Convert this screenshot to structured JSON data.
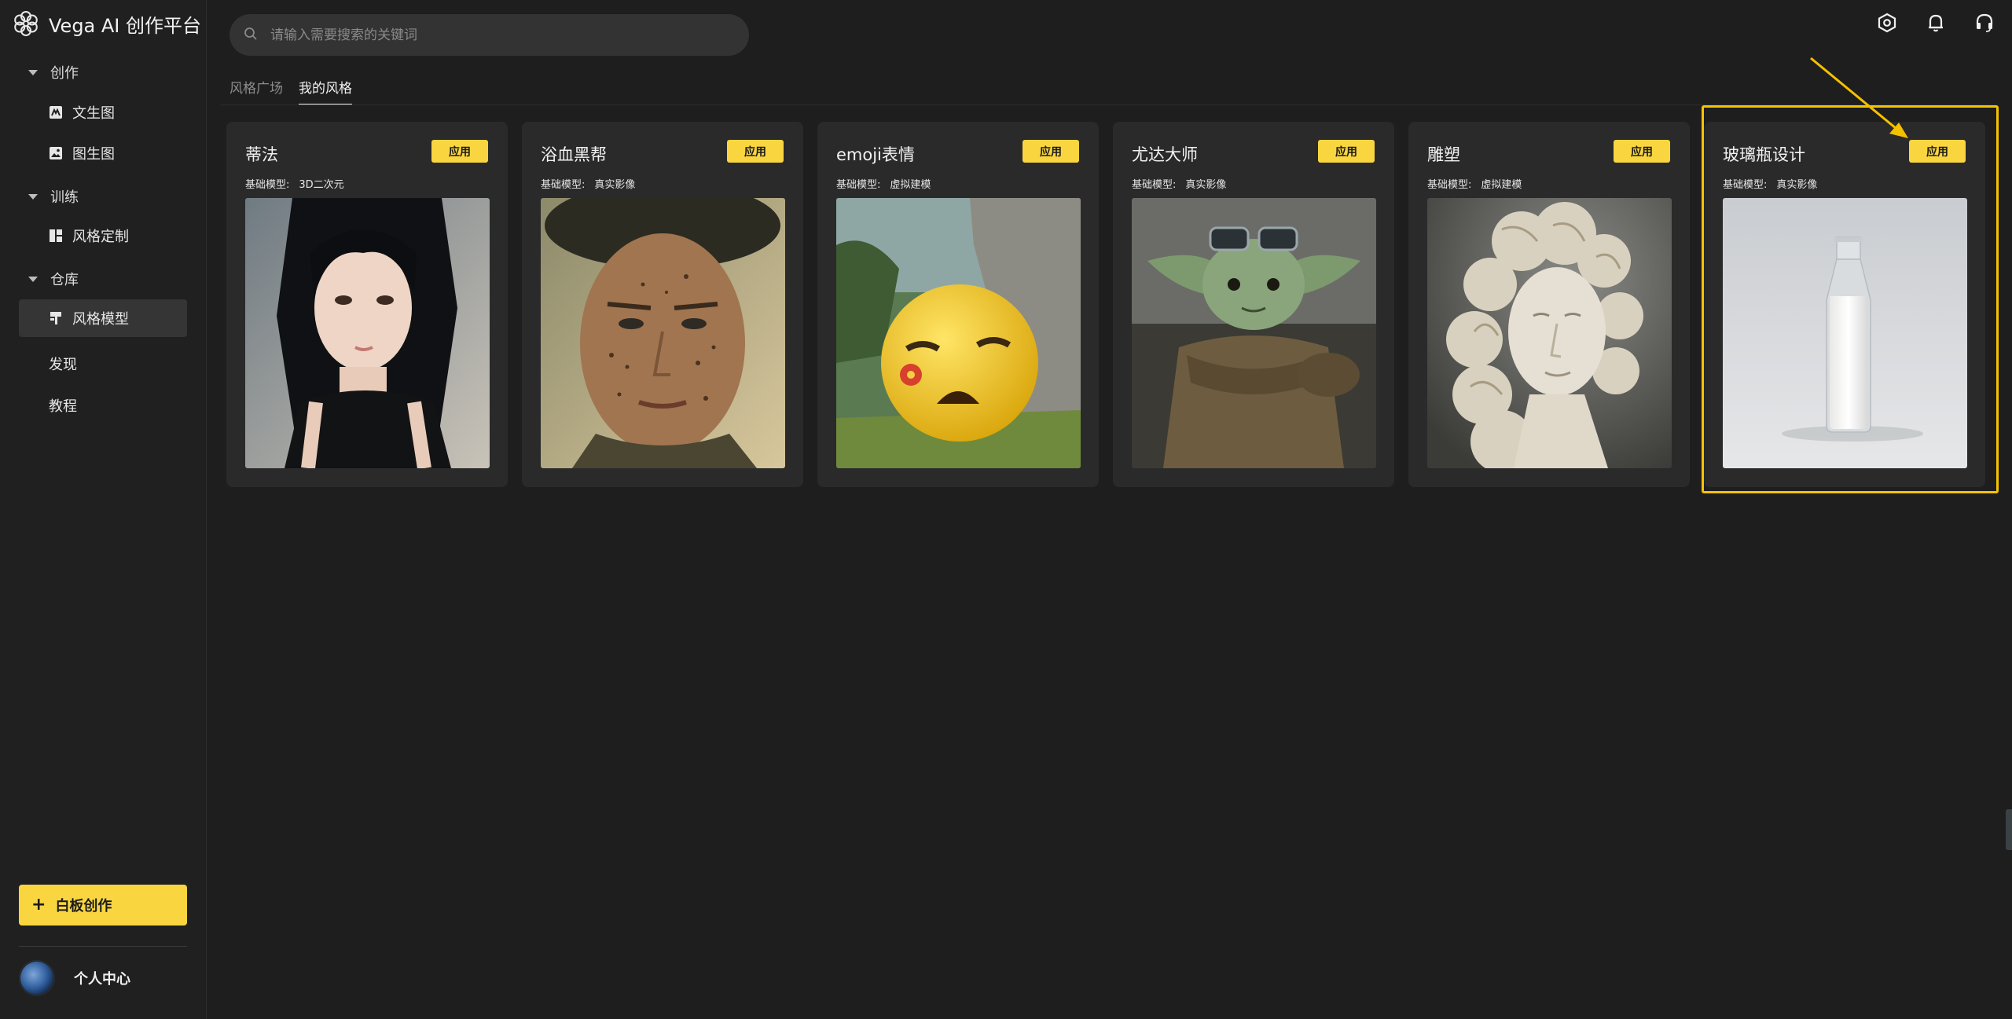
{
  "app": {
    "title": "Vega AI 创作平台"
  },
  "sidebar": {
    "groups": [
      {
        "title": "创作",
        "items": [
          {
            "label": "文生图",
            "icon": "text-to-image-icon"
          },
          {
            "label": "图生图",
            "icon": "image-to-image-icon"
          }
        ]
      },
      {
        "title": "训练",
        "items": [
          {
            "label": "风格定制",
            "icon": "style-custom-icon"
          }
        ]
      },
      {
        "title": "仓库",
        "items": [
          {
            "label": "风格模型",
            "icon": "style-model-icon",
            "active": true
          }
        ]
      }
    ],
    "links": [
      "发现",
      "教程"
    ],
    "whiteboard_button": "白板创作",
    "profile_label": "个人中心"
  },
  "search": {
    "placeholder": "请输入需要搜索的关键词"
  },
  "header_icons": [
    "settings-hexagon-icon",
    "bell-icon",
    "headset-icon"
  ],
  "tabs": [
    {
      "label": "风格广场",
      "active": false
    },
    {
      "label": "我的风格",
      "active": true
    }
  ],
  "cards": [
    {
      "title": "蒂法",
      "button": "应用",
      "model_key": "基础模型:",
      "model_value": "3D二次元",
      "image": "anime-girl-portrait"
    },
    {
      "title": "浴血黑帮",
      "button": "应用",
      "model_key": "基础模型:",
      "model_value": "真实影像",
      "image": "man-portrait-flat-cap"
    },
    {
      "title": "emoji表情",
      "button": "应用",
      "model_key": "基础模型:",
      "model_value": "虚拟建模",
      "image": "sad-emoji-ball"
    },
    {
      "title": "尤达大师",
      "button": "应用",
      "model_key": "基础模型:",
      "model_value": "真实影像",
      "image": "baby-yoda-sunglasses"
    },
    {
      "title": "雕塑",
      "button": "应用",
      "model_key": "基础模型:",
      "model_value": "虚拟建模",
      "image": "marble-bust"
    },
    {
      "title": "玻璃瓶设计",
      "button": "应用",
      "model_key": "基础模型:",
      "model_value": "真实影像",
      "image": "milk-glass-bottle"
    }
  ],
  "colors": {
    "accent": "#f9d640",
    "highlight": "#f5c400",
    "background": "#1e1e1e",
    "card": "#2a2a2a"
  }
}
